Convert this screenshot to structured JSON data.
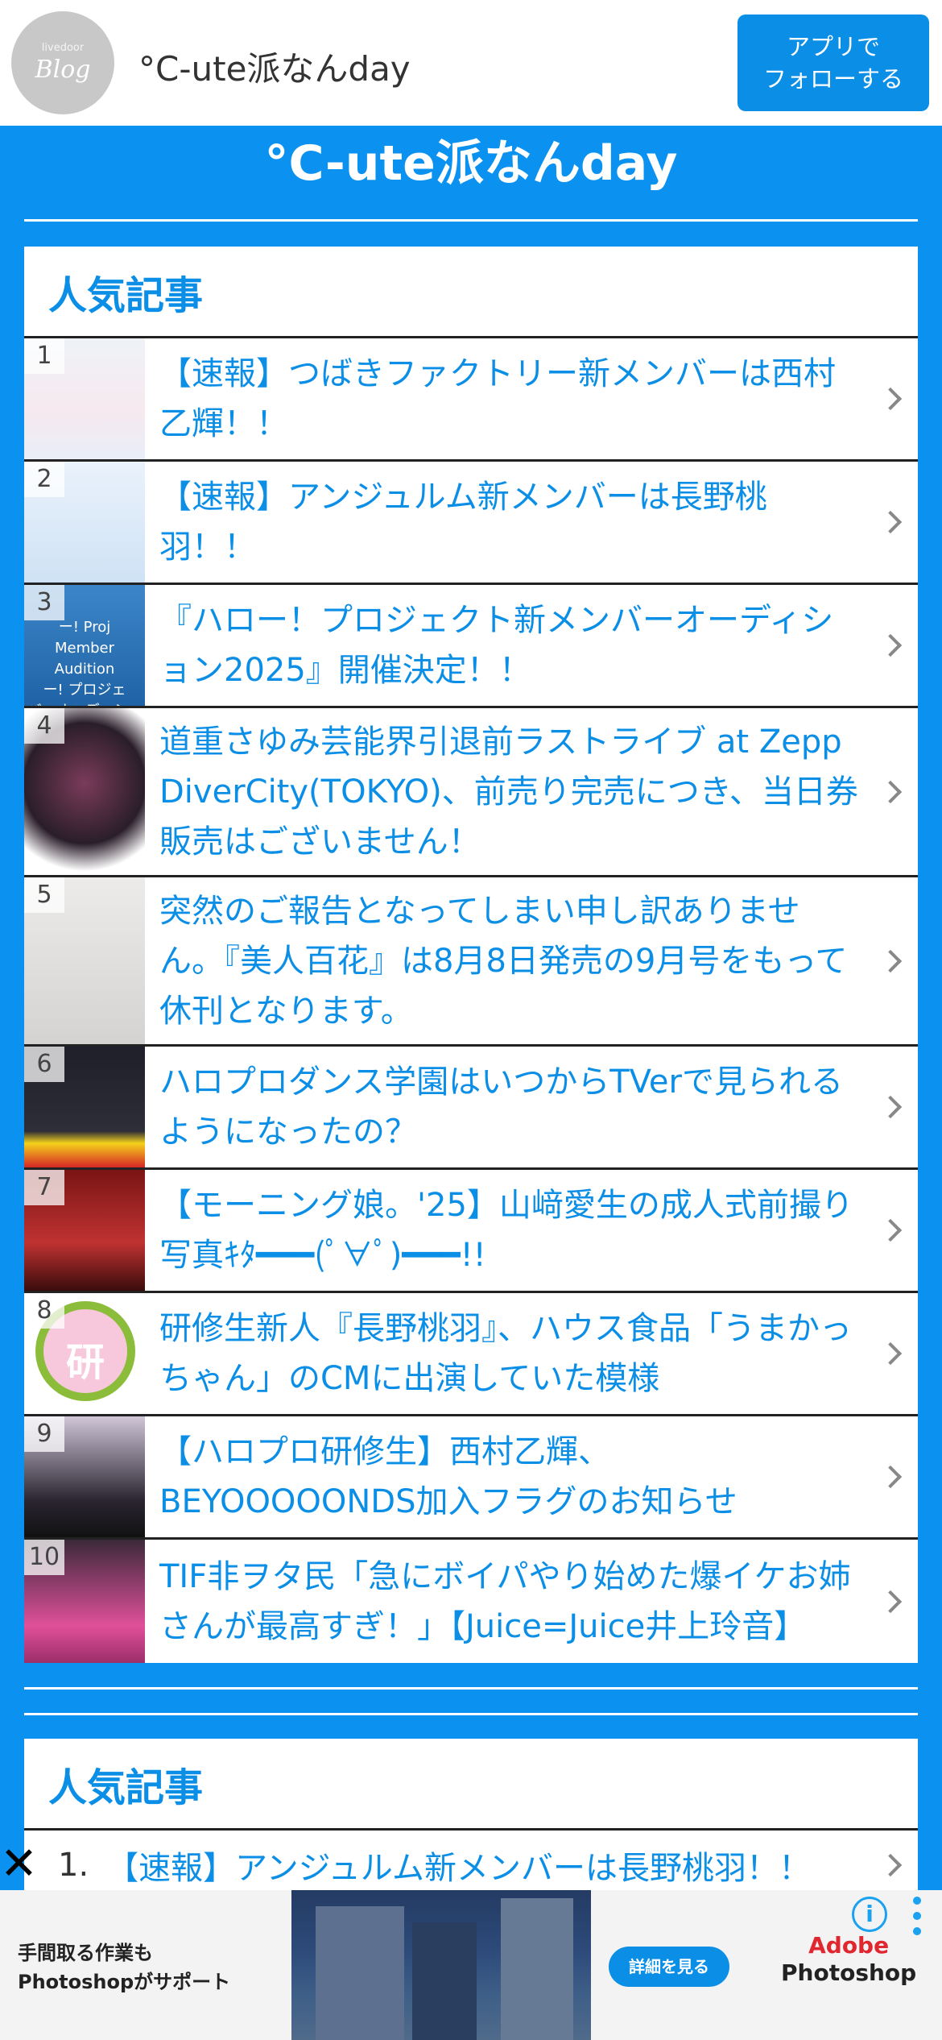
{
  "header": {
    "logo_small": "livedoor",
    "logo_big": "Blog",
    "blog_name": "°C-ute派なんday",
    "follow_button": "アプリで\nフォローする"
  },
  "site_title": "°C-ute派なんday",
  "popular_widget": {
    "title": "人気記事",
    "items": [
      {
        "rank": "1",
        "title": "【速報】つばきファクトリー新メンバーは西村乙輝！！"
      },
      {
        "rank": "2",
        "title": "【速報】アンジュルム新メンバーは長野桃羽！！"
      },
      {
        "rank": "3",
        "title": "『ハロー！プロジェクト新メンバーオーディション2025』開催決定！！",
        "thumb_text": "ー! Proj\nMember Audition\nー! プロジェ\nバーオーディション"
      },
      {
        "rank": "4",
        "title": "道重さゆみ芸能界引退前ラストライブ at Zepp DiverCity(TOKYO)、前売り完売につき、当日券販売はございません！"
      },
      {
        "rank": "5",
        "title": "突然のご報告となってしまい申し訳ありません。『美人百花』は8月8日発売の9月号をもって休刊となります。"
      },
      {
        "rank": "6",
        "title": "ハロプロダンス学園はいつからTVerで見られるようになったの？"
      },
      {
        "rank": "7",
        "title": "【モーニング娘。'25】山﨑愛生の成人式前撮り写真ｷﾀ━━━(ﾟ∀ﾟ)━━━!!"
      },
      {
        "rank": "8",
        "title": "研修生新人『長野桃羽』、ハウス食品「うまかっちゃん」のCMに出演していた模様",
        "thumb_text": "研"
      },
      {
        "rank": "9",
        "title": "【ハロプロ研修生】西村乙輝、BEYOOOOONDS加入フラグのお知らせ"
      },
      {
        "rank": "10",
        "title": "TIF非ヲタ民「急にボイパやり始めた爆イケお姉さんが最高すぎ！」【Juice=Juice井上玲音】"
      }
    ]
  },
  "popular_widget2": {
    "title": "人気記事",
    "items": [
      {
        "num": "1.",
        "title": "【速報】アンジュルム新メンバーは長野桃羽！！"
      }
    ]
  },
  "ad": {
    "close": "✕",
    "copy": "手間取る作業も\nPhotoshopがサポート",
    "detail_button": "詳細を見る",
    "brand_top": "Adobe",
    "brand_bottom": "Photoshop",
    "info": "i"
  }
}
